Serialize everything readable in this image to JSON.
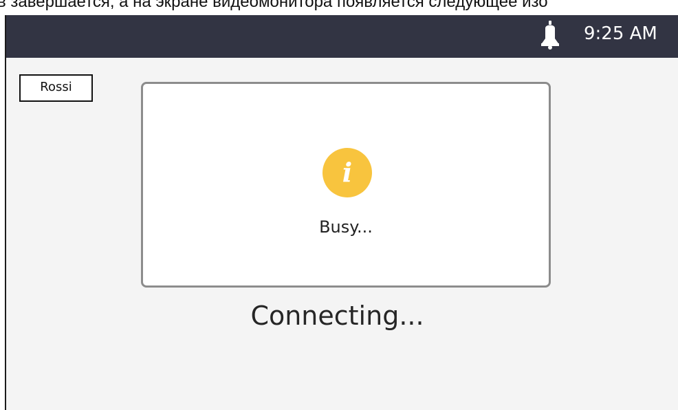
{
  "caption": {
    "text": "в завершается, а на экране видеомонитора появляется следующее изо"
  },
  "status_bar": {
    "bell_icon": "bell-icon",
    "time": "9:25 AM",
    "background": "#323443"
  },
  "contact": {
    "name": "Rossi"
  },
  "dialog": {
    "icon": "info-icon",
    "icon_glyph": "i",
    "icon_color": "#f8c43e",
    "message": "Busy..."
  },
  "call_status": {
    "text": "Connecting..."
  }
}
